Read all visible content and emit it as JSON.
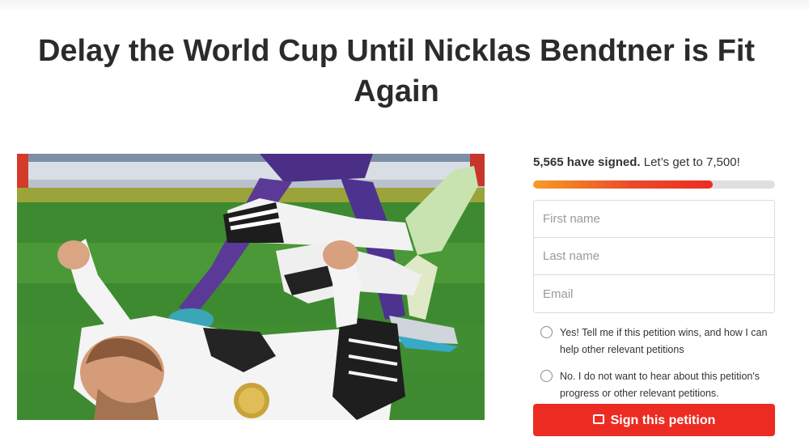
{
  "petition": {
    "title": "Delay the World Cup Until Nicklas Bendtner is Fit Again",
    "image_alt": "Footballer lying injured on the pitch"
  },
  "signatures": {
    "count_text": "5,565 have signed.",
    "goal_text": "Let’s get to 7,500!",
    "progress_fraction": 0.742
  },
  "form": {
    "first_name_placeholder": "First name",
    "last_name_placeholder": "Last name",
    "email_placeholder": "Email",
    "option_yes": "Yes! Tell me if this petition wins, and how I can help other relevant petitions",
    "option_no": "No. I do not want to hear about this petition's progress or other relevant petitions.",
    "submit_label": "Sign this petition"
  },
  "colors": {
    "accent": "#ec2c22",
    "progress_start": "#f79b25",
    "track": "#e0e0e0"
  }
}
